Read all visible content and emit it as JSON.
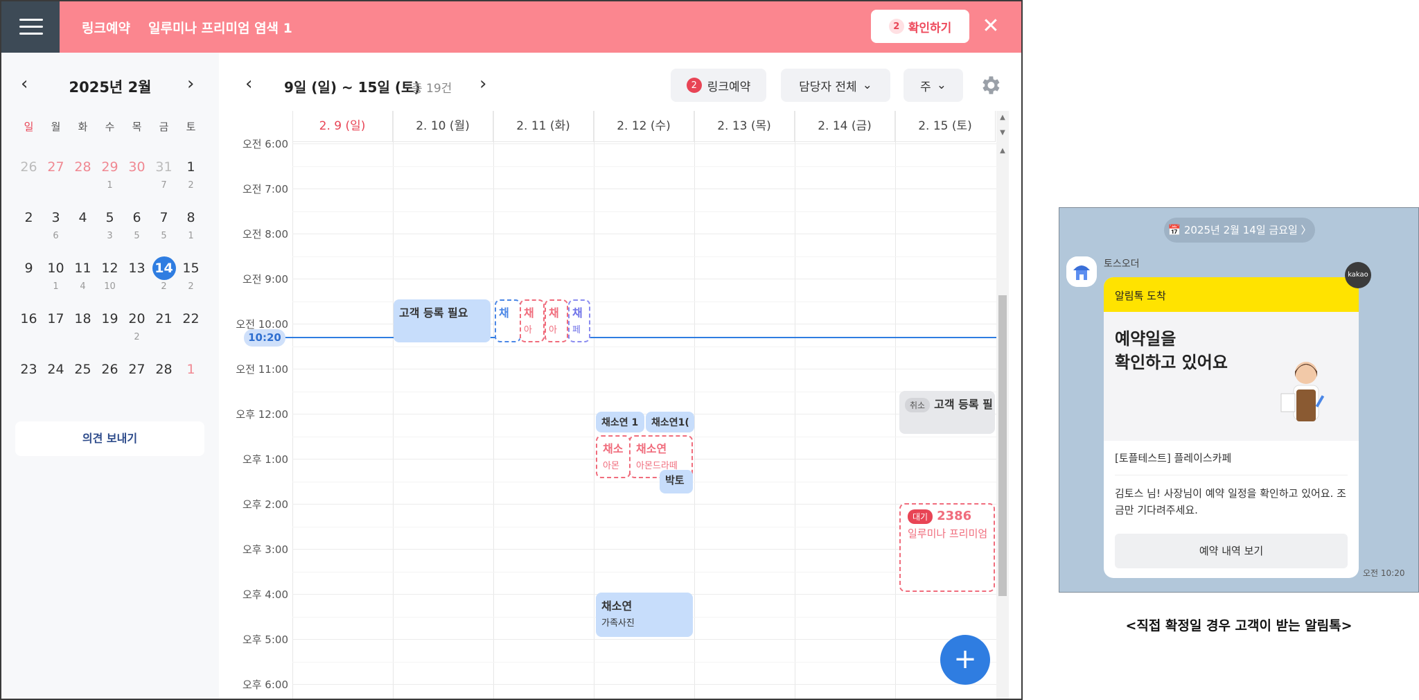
{
  "header": {
    "title": "링크예약",
    "subtitle": "일루미나 프리미엄 염색 1",
    "confirm_count": "2",
    "confirm_label": "확인하기",
    "close_symbol": "✕"
  },
  "mini_calendar": {
    "title": "2025년 2월",
    "prev_symbol": "‹",
    "next_symbol": "›",
    "weekdays": [
      "일",
      "월",
      "화",
      "수",
      "목",
      "금",
      "토"
    ],
    "days": [
      {
        "n": "26",
        "c": ""
      },
      {
        "n": "27",
        "c": ""
      },
      {
        "n": "28",
        "c": ""
      },
      {
        "n": "29",
        "c": "1"
      },
      {
        "n": "30",
        "c": ""
      },
      {
        "n": "31",
        "c": "7"
      },
      {
        "n": "1",
        "c": "2"
      },
      {
        "n": "2",
        "c": ""
      },
      {
        "n": "3",
        "c": "6"
      },
      {
        "n": "4",
        "c": ""
      },
      {
        "n": "5",
        "c": "3"
      },
      {
        "n": "6",
        "c": "5"
      },
      {
        "n": "7",
        "c": "5"
      },
      {
        "n": "8",
        "c": "1"
      },
      {
        "n": "9",
        "c": ""
      },
      {
        "n": "10",
        "c": "1"
      },
      {
        "n": "11",
        "c": "4"
      },
      {
        "n": "12",
        "c": "10"
      },
      {
        "n": "13",
        "c": ""
      },
      {
        "n": "14",
        "c": "2"
      },
      {
        "n": "15",
        "c": "2"
      },
      {
        "n": "16",
        "c": ""
      },
      {
        "n": "17",
        "c": ""
      },
      {
        "n": "18",
        "c": ""
      },
      {
        "n": "19",
        "c": ""
      },
      {
        "n": "20",
        "c": "2"
      },
      {
        "n": "21",
        "c": ""
      },
      {
        "n": "22",
        "c": ""
      },
      {
        "n": "23",
        "c": ""
      },
      {
        "n": "24",
        "c": ""
      },
      {
        "n": "25",
        "c": ""
      },
      {
        "n": "26",
        "c": ""
      },
      {
        "n": "27",
        "c": ""
      },
      {
        "n": "28",
        "c": ""
      },
      {
        "n": "1",
        "c": ""
      }
    ],
    "feedback_label": "의견 보내기"
  },
  "toolbar": {
    "prev_symbol": "‹",
    "next_symbol": "›",
    "range": "9일 (일) ~ 15일 (토)",
    "total": "총 19건",
    "link_count": "2",
    "link_label": "링크예약",
    "staff_label": "담당자 전체",
    "view_label": "주",
    "chevron": "⌄"
  },
  "columns": [
    "2. 9 (일)",
    "2. 10 (월)",
    "2. 11 (화)",
    "2. 12 (수)",
    "2. 13 (목)",
    "2. 14 (금)",
    "2. 15 (토)"
  ],
  "times": [
    "오전 6:00",
    "오전 7:00",
    "오전 8:00",
    "오전 9:00",
    "오전 10:00",
    "오전 11:00",
    "오후 12:00",
    "오후 1:00",
    "오후 2:00",
    "오후 3:00",
    "오후 4:00",
    "오후 5:00",
    "오후 6:00"
  ],
  "now_label": "10:20",
  "events": {
    "mon_customer": "고객 등록 필요",
    "tue_1": "채",
    "tue_2": "채",
    "tue_2_sub": "아",
    "tue_3": "채",
    "tue_3_sub": "아",
    "tue_4": "채",
    "tue_4_sub": "페",
    "wed_a": "채소연",
    "wed_a_time": "1",
    "wed_b": "채소연",
    "wed_b_time": "1(",
    "wed_c": "채소",
    "wed_c_sub": "아몬",
    "wed_d": "채소연",
    "wed_d_sub": "아몬드라떼",
    "wed_e": "박토",
    "wed_f": "채소연",
    "wed_f_sub": "가족사진",
    "sat_cancel_tag": "취소",
    "sat_cancel": "고객 등록 필",
    "sat_wait_tag": "대기",
    "sat_wait": "2386",
    "sat_wait_sub": "일루미나 프리미엄"
  },
  "fab_symbol": "+",
  "kakao": {
    "date": "📅 2025년 2월 14일 금요일 〉",
    "sender": "토스오더",
    "badge": "kakao",
    "top_label": "알림톡 도착",
    "heading": "예약일을\n확인하고 있어요",
    "store": "[토플테스트] 플레이스카페",
    "message": "김토스 님! 사장님이 예약 일정을 확인하고 있어요. 조금만 기다려주세요.",
    "button": "예약 내역 보기",
    "time": "오전 10:20"
  },
  "caption": "<직접 확정일 경우 고객이 받는 알림톡>",
  "colors": {
    "header": "#fb868f",
    "accent_blue": "#2f7de1",
    "sunday_red": "#e84455",
    "kakao_yellow": "#ffe300",
    "kakao_bg": "#b2c7da"
  }
}
